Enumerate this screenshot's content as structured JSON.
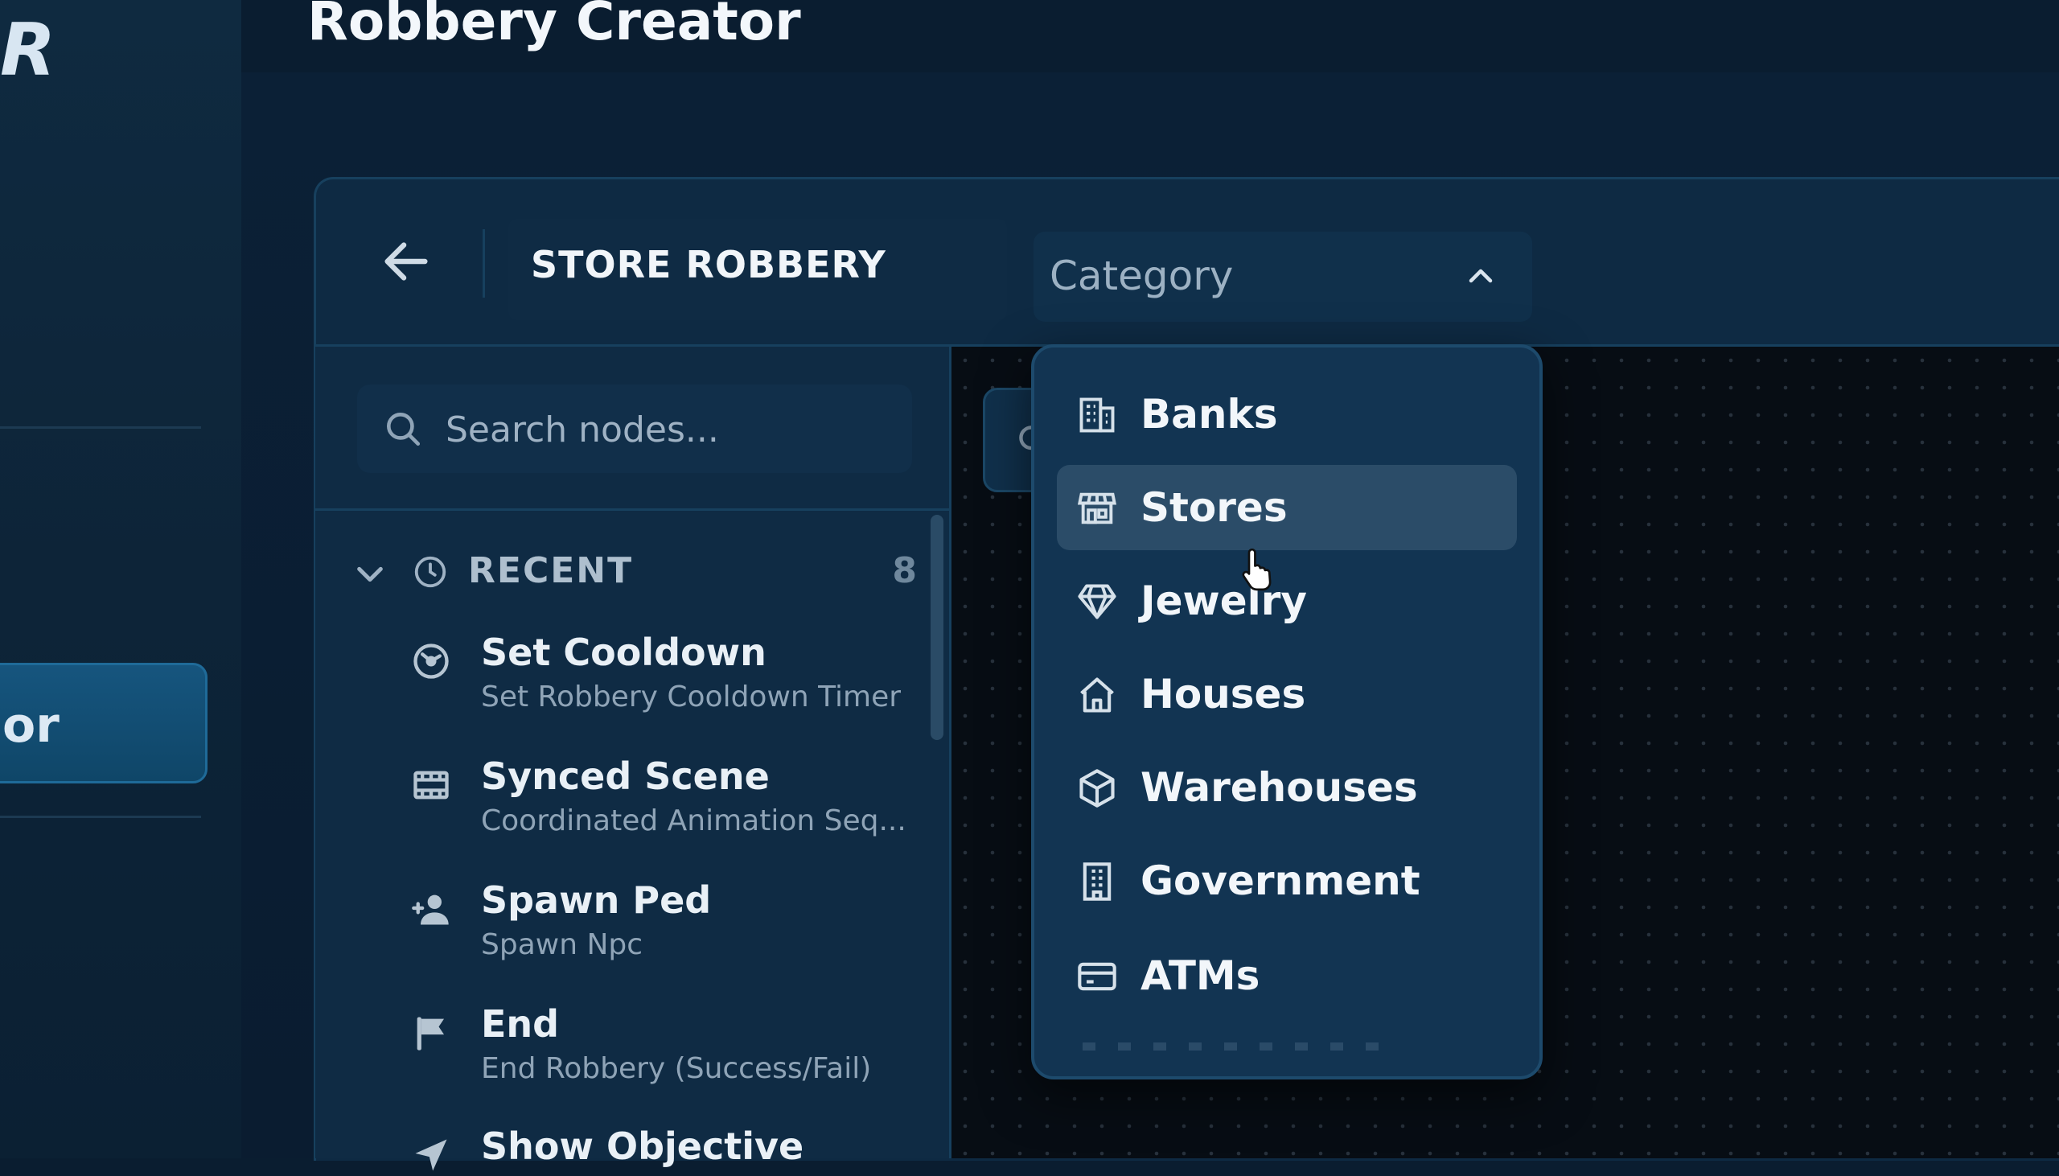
{
  "app": {
    "brand_letter": "R",
    "title": "Robbery Creator",
    "sidebar_active_text": "or"
  },
  "header": {
    "robbery_title": "STORE ROBBERY",
    "category_placeholder": "Category"
  },
  "node_panel": {
    "search": {
      "placeholder": "Search nodes..."
    },
    "recent": {
      "label": "RECENT",
      "count": "8"
    },
    "nodes": [
      {
        "title": "Set Cooldown",
        "subtitle": "Set Robbery Cooldown Timer",
        "icon": "cooldown-icon"
      },
      {
        "title": "Synced Scene",
        "subtitle": "Coordinated Animation Seq...",
        "icon": "film-icon"
      },
      {
        "title": "Spawn Ped",
        "subtitle": "Spawn Npc",
        "icon": "user-plus-icon"
      },
      {
        "title": "End",
        "subtitle": "End Robbery (Success/Fail)",
        "icon": "flag-icon"
      },
      {
        "title": "Show Objective",
        "subtitle": "",
        "icon": "navigation-icon"
      }
    ]
  },
  "category_dropdown": {
    "selected": "Stores",
    "options": [
      {
        "label": "Banks",
        "icon": "bank-building-icon"
      },
      {
        "label": "Stores",
        "icon": "storefront-icon"
      },
      {
        "label": "Jewelry",
        "icon": "diamond-icon"
      },
      {
        "label": "Houses",
        "icon": "house-icon"
      },
      {
        "label": "Warehouses",
        "icon": "box-icon"
      },
      {
        "label": "Government",
        "icon": "government-building-icon"
      },
      {
        "label": "ATMs",
        "icon": "card-icon"
      }
    ]
  },
  "colors": {
    "accent": "#16557e",
    "panel": "#0f2b44",
    "dropdown": "#123452",
    "selected_option": "#2b4c68",
    "canvas": "#070d14"
  }
}
